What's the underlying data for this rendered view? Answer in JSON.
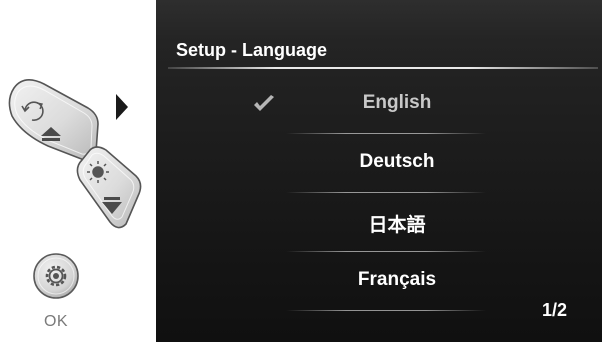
{
  "screen": {
    "title": "Setup - Language",
    "languages": [
      {
        "label": "English",
        "selected": true
      },
      {
        "label": "Deutsch",
        "selected": false
      },
      {
        "label": "日本語",
        "selected": false
      },
      {
        "label": "Français",
        "selected": false
      }
    ],
    "page_indicator": "1/2"
  },
  "controls": {
    "ok_label": "OK",
    "buttons": [
      {
        "name": "rotate-up-button",
        "icons": [
          "rotate-icon",
          "arrow-up-icon"
        ]
      },
      {
        "name": "brightness-down-button",
        "icons": [
          "brightness-icon",
          "arrow-down-icon"
        ]
      },
      {
        "name": "ok-button",
        "icons": [
          "gear-icon"
        ]
      }
    ]
  },
  "colors": {
    "screen_background": "#1d1d1d",
    "text_primary": "#ffffff",
    "text_selected": "#c8c8c8",
    "button_body": "#dcdcdc",
    "label_gray": "#7a7a7a"
  }
}
